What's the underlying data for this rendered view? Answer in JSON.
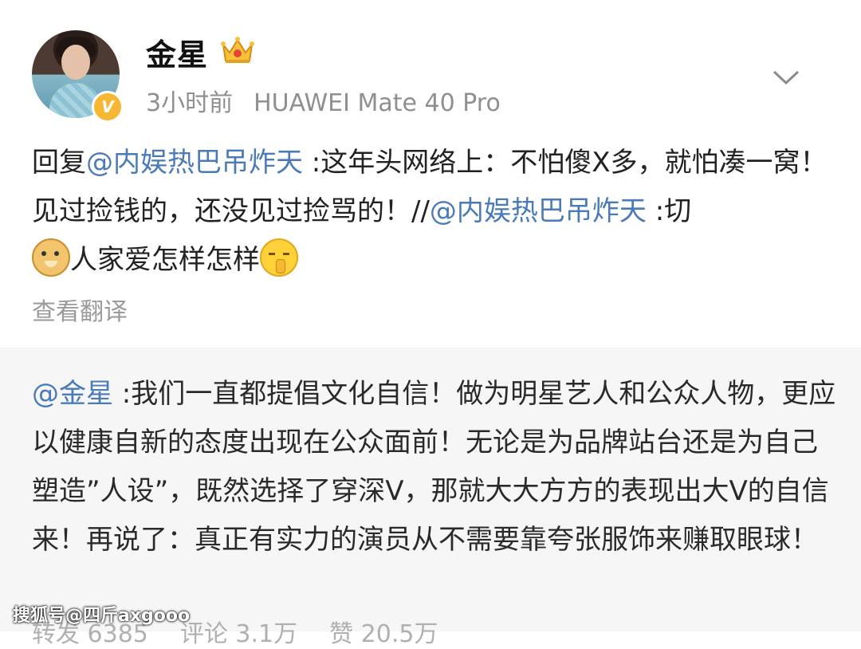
{
  "post": {
    "avatar": "avatar",
    "username": "金星",
    "badge_icon": "crown-icon",
    "verified_mark": "V",
    "time": "3小时前",
    "device": "HUAWEI Mate 40 Pro",
    "menu_icon": "chevron-down-icon",
    "text": {
      "prefix": "回复",
      "mention1": "@内娱热巴吊炸天",
      "part1": " :这年头网络上：不怕傻X多，就怕凑一窝！见过捡钱的，还没见过捡骂的！//",
      "mention2": "@内娱热巴吊炸天",
      "part2": " :切",
      "emoji1": "doge-emoji",
      "part3": "人家爱怎样怎样",
      "emoji2": "shush-emoji"
    },
    "translate_label": "查看翻译"
  },
  "retweet": {
    "mention": "@金星",
    "text": " :我们一直都提倡文化自信！做为明星艺人和公众人物，更应以健康自新的态度出现在公众面前！无论是为品牌站台还是为自己塑造”人设”，既然选择了穿深V，那就大大方方的表现出大V的自信来！再说了：真正有实力的演员从不需要靠夸张服饰来赚取眼球！",
    "stats": {
      "repost": "转发 6385",
      "comments": "评论 3.1万",
      "likes": "赞 20.5万"
    }
  },
  "watermark": "搜狐号@四斤axgooo",
  "colors": {
    "mention": "#4a7ab8",
    "meta_gray": "#8f8f8f",
    "retweet_bg": "#f6f6f6",
    "verified": "#f7b733"
  }
}
